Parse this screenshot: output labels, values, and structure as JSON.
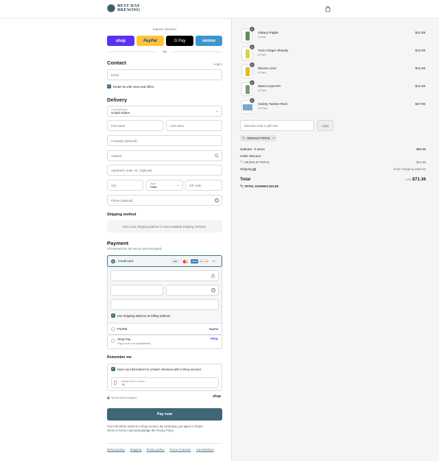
{
  "brand": {
    "line1": "BEST DAY",
    "line2": "BREWING"
  },
  "express": {
    "label": "Express checkout",
    "shop": "shop",
    "paypal": "PayPal",
    "gpay": "G Pay",
    "venmo": "venmo",
    "or": "OR"
  },
  "contact": {
    "heading": "Contact",
    "login_link": "Log in",
    "email_placeholder": "Email",
    "news_label": "Email me with news and offers"
  },
  "delivery": {
    "heading": "Delivery",
    "country_label": "Country/Region",
    "country_value": "United States",
    "first_name": "First name",
    "last_name": "Last name",
    "company": "Company (optional)",
    "address": "Address",
    "apartment": "Apartment, suite, etc. (optional)",
    "city": "City",
    "state_label": "State",
    "state_value": "Iowa",
    "zip": "ZIP code",
    "phone": "Phone (optional)"
  },
  "shipping": {
    "heading": "Shipping method",
    "placeholder": "Enter your shipping address to view available shipping methods."
  },
  "payment": {
    "heading": "Payment",
    "subtitle": "All transactions are secure and encrypted.",
    "credit_card": "Credit card",
    "card_more": "+4",
    "card_brands": {
      "visa": "VISA",
      "discover": "DISCOVER",
      "amex": "AMEX"
    },
    "billing_label": "Use shipping address as billing address",
    "paypal": "PayPal",
    "paypal_logo": "PayPal",
    "shop_pay": "Shop Pay",
    "shop_pay_sub": "Pay in full or in installments",
    "shop_logo": "shop"
  },
  "remember": {
    "heading": "Remember me",
    "save_label": "Save my information for a faster checkout with a Shop account",
    "mobile_label": "Mobile phone number",
    "mobile_value": "+1",
    "secure": "Secure and encrypted",
    "shop_logo": "shop"
  },
  "pay_now": "Pay now",
  "legal": {
    "text1": "Your info will be saved to a Shop account. By continuing, you agree to Shop's",
    "terms": "Terms of Service",
    "text2": "and acknowledge the",
    "privacy": "Privacy Policy",
    "end": "."
  },
  "footer_links": [
    "Refund policy",
    "Shipping",
    "Privacy policy",
    "Terms of service",
    "Cancellations"
  ],
  "items": [
    {
      "qty": "1",
      "name": "Galaxy Ripple",
      "variant": "6-pack",
      "price": "$13.99",
      "color": "#5f8f5a"
    },
    {
      "qty": "1",
      "name": "Yuzu Ginger Shandy",
      "variant": "6-Pack",
      "price": "$13.99",
      "color": "#d9d34a"
    },
    {
      "qty": "1",
      "name": "Electro Lime",
      "variant": "6-Pack",
      "price": "$13.99",
      "color": "#e6b82a"
    },
    {
      "qty": "1",
      "name": "West Coast IPA",
      "variant": "6-Pack",
      "price": "$13.99",
      "color": "#7b9a77"
    },
    {
      "qty": "1",
      "name": "Variety Twelve-Pack",
      "variant": "12-Pack",
      "price": "$27.99",
      "color": "#7aa7c7"
    }
  ],
  "discount": {
    "placeholder": "Discount code or gift card",
    "apply": "Apply",
    "tag": "NEWSLETTER15"
  },
  "summary": {
    "subtotal_label": "Subtotal · 5 items",
    "subtotal": "$83.95",
    "order_discount": "Order discount",
    "discount_code": "NEWSLETTER15",
    "discount_amount": "- $12.59",
    "shipping_label": "Shipping",
    "shipping_value": "Enter shipping address",
    "total_label": "Total",
    "currency": "USD",
    "total": "$71.36",
    "savings_label": "TOTAL SAVINGS",
    "savings": "$12.59"
  },
  "colors": {
    "accent": "#3d6a7a",
    "pay_button": "#3f6676"
  }
}
